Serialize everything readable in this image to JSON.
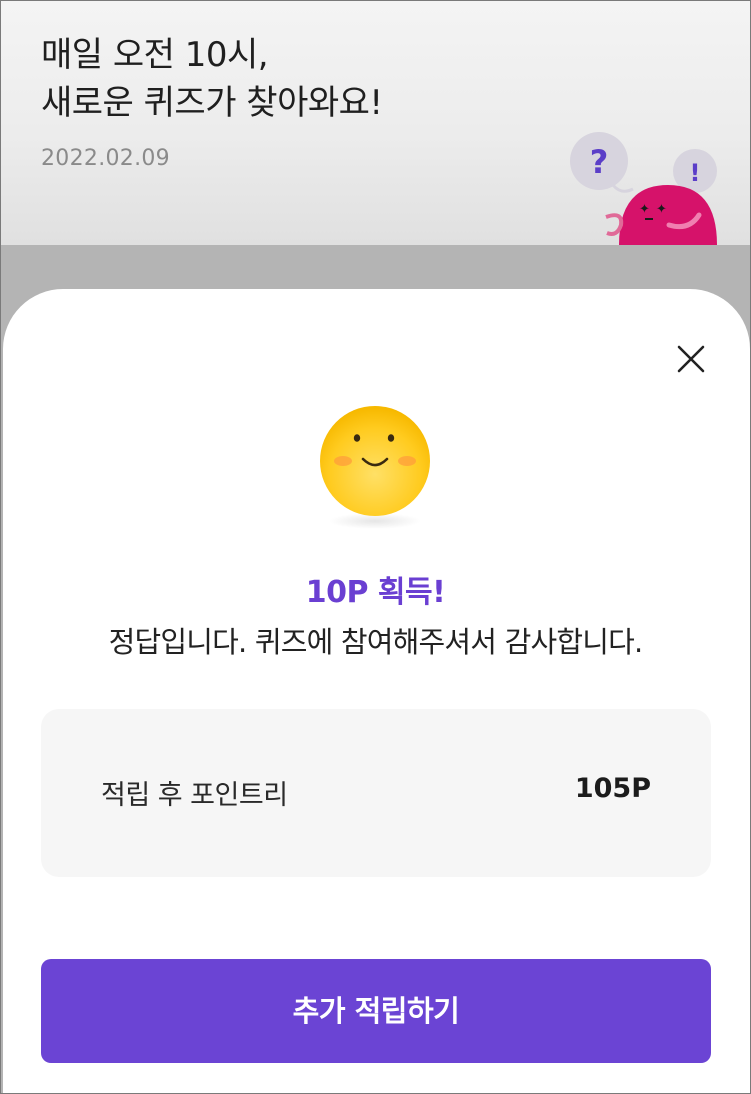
{
  "background": {
    "title_line1": "매일 오전 10시,",
    "title_line2": "새로운 퀴즈가 찾아와요!",
    "date": "2022.02.09",
    "mascot_bubble_1": "?",
    "mascot_bubble_2": "!"
  },
  "sheet": {
    "close_icon": "close-icon",
    "emoji_icon": "smiling-face-icon",
    "reward_text": "10P 획득!",
    "message": "정답입니다. 퀴즈에 참여해주셔서 감사합니다.",
    "points": {
      "label": "적립 후 포인트리",
      "value": "105P"
    },
    "button_label": "추가 적립하기"
  },
  "colors": {
    "accent": "#6b44d4",
    "reward_text": "#6a3fd2",
    "mascot": "#d6126a",
    "emoji": "#ffc91a"
  }
}
